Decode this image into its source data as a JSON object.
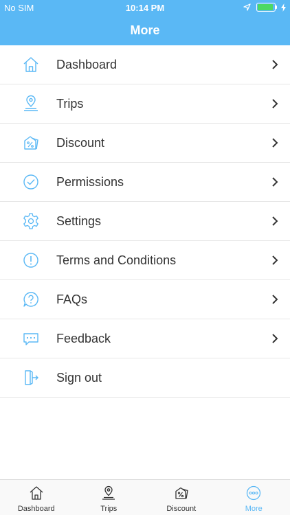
{
  "status_bar": {
    "carrier": "No SIM",
    "time": "10:14 PM",
    "battery_level": 0.9
  },
  "header": {
    "title": "More"
  },
  "colors": {
    "accent": "#5ab8f5",
    "text": "#333333",
    "divider": "#e6e6e6",
    "battery": "#4cd964"
  },
  "menu": {
    "items": [
      {
        "label": "Dashboard",
        "icon": "home-icon",
        "chevron": true
      },
      {
        "label": "Trips",
        "icon": "location-pin-icon",
        "chevron": true
      },
      {
        "label": "Discount",
        "icon": "discount-tag-icon",
        "chevron": true
      },
      {
        "label": "Permissions",
        "icon": "checkmark-circle-icon",
        "chevron": true
      },
      {
        "label": "Settings",
        "icon": "gear-icon",
        "chevron": true
      },
      {
        "label": "Terms and Conditions",
        "icon": "info-circle-icon",
        "chevron": true
      },
      {
        "label": "FAQs",
        "icon": "question-bubble-icon",
        "chevron": true
      },
      {
        "label": "Feedback",
        "icon": "chat-bubble-icon",
        "chevron": true
      },
      {
        "label": "Sign out",
        "icon": "sign-out-icon",
        "chevron": false
      }
    ]
  },
  "tabbar": {
    "tabs": [
      {
        "label": "Dashboard",
        "icon": "home-icon",
        "active": false
      },
      {
        "label": "Trips",
        "icon": "location-pin-icon",
        "active": false
      },
      {
        "label": "Discount",
        "icon": "discount-tag-icon",
        "active": false
      },
      {
        "label": "More",
        "icon": "more-dots-icon",
        "active": true
      }
    ]
  }
}
